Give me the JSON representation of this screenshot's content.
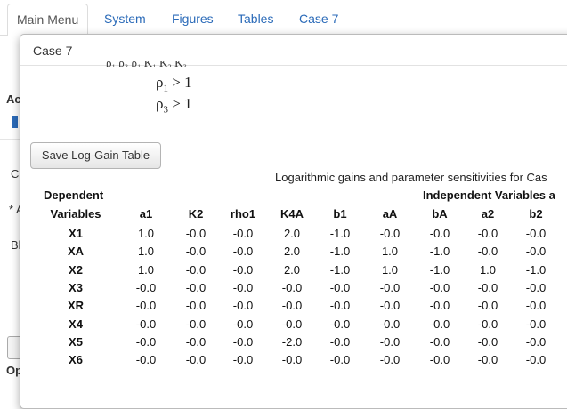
{
  "tabs": [
    {
      "label": "Main Menu",
      "active": true
    },
    {
      "label": "System",
      "active": false
    },
    {
      "label": "Figures",
      "active": false
    },
    {
      "label": "Tables",
      "active": false
    },
    {
      "label": "Case 7",
      "active": false
    }
  ],
  "background": {
    "frag_ac": "Ac",
    "frag_c": "C",
    "frag_star": "* A",
    "frag_b": "Bl",
    "frag_op": "Op"
  },
  "modal": {
    "title": "Case 7",
    "equations": [
      {
        "symbol": "ρ",
        "sub": "1",
        "op": " > 1"
      },
      {
        "symbol": "ρ",
        "sub": "3",
        "op": " > 1"
      }
    ],
    "save_label": "Save Log-Gain Table",
    "caption": "Logarithmic gains and parameter sensitivities for Cas",
    "table": {
      "dependent_header": "Dependent",
      "variables_header": "Variables",
      "independent_header": "Independent Variables a",
      "columns": [
        "a1",
        "K2",
        "rho1",
        "K4A",
        "b1",
        "aA",
        "bA",
        "a2",
        "b2"
      ],
      "rows": [
        {
          "name": "X1",
          "values": [
            "1.0",
            "-0.0",
            "-0.0",
            "2.0",
            "-1.0",
            "-0.0",
            "-0.0",
            "-0.0",
            "-0.0"
          ]
        },
        {
          "name": "XA",
          "values": [
            "1.0",
            "-0.0",
            "-0.0",
            "2.0",
            "-1.0",
            "1.0",
            "-1.0",
            "-0.0",
            "-0.0"
          ]
        },
        {
          "name": "X2",
          "values": [
            "1.0",
            "-0.0",
            "-0.0",
            "2.0",
            "-1.0",
            "1.0",
            "-1.0",
            "1.0",
            "-1.0"
          ]
        },
        {
          "name": "X3",
          "values": [
            "-0.0",
            "-0.0",
            "-0.0",
            "-0.0",
            "-0.0",
            "-0.0",
            "-0.0",
            "-0.0",
            "-0.0"
          ]
        },
        {
          "name": "XR",
          "values": [
            "-0.0",
            "-0.0",
            "-0.0",
            "-0.0",
            "-0.0",
            "-0.0",
            "-0.0",
            "-0.0",
            "-0.0"
          ]
        },
        {
          "name": "X4",
          "values": [
            "-0.0",
            "-0.0",
            "-0.0",
            "-0.0",
            "-0.0",
            "-0.0",
            "-0.0",
            "-0.0",
            "-0.0"
          ]
        },
        {
          "name": "X5",
          "values": [
            "-0.0",
            "-0.0",
            "-0.0",
            "-2.0",
            "-0.0",
            "-0.0",
            "-0.0",
            "-0.0",
            "-0.0"
          ]
        },
        {
          "name": "X6",
          "values": [
            "-0.0",
            "-0.0",
            "-0.0",
            "-0.0",
            "-0.0",
            "-0.0",
            "-0.0",
            "-0.0",
            "-0.0"
          ]
        }
      ]
    }
  },
  "colors": {
    "link": "#2a6ab8",
    "border": "#dddddd"
  }
}
